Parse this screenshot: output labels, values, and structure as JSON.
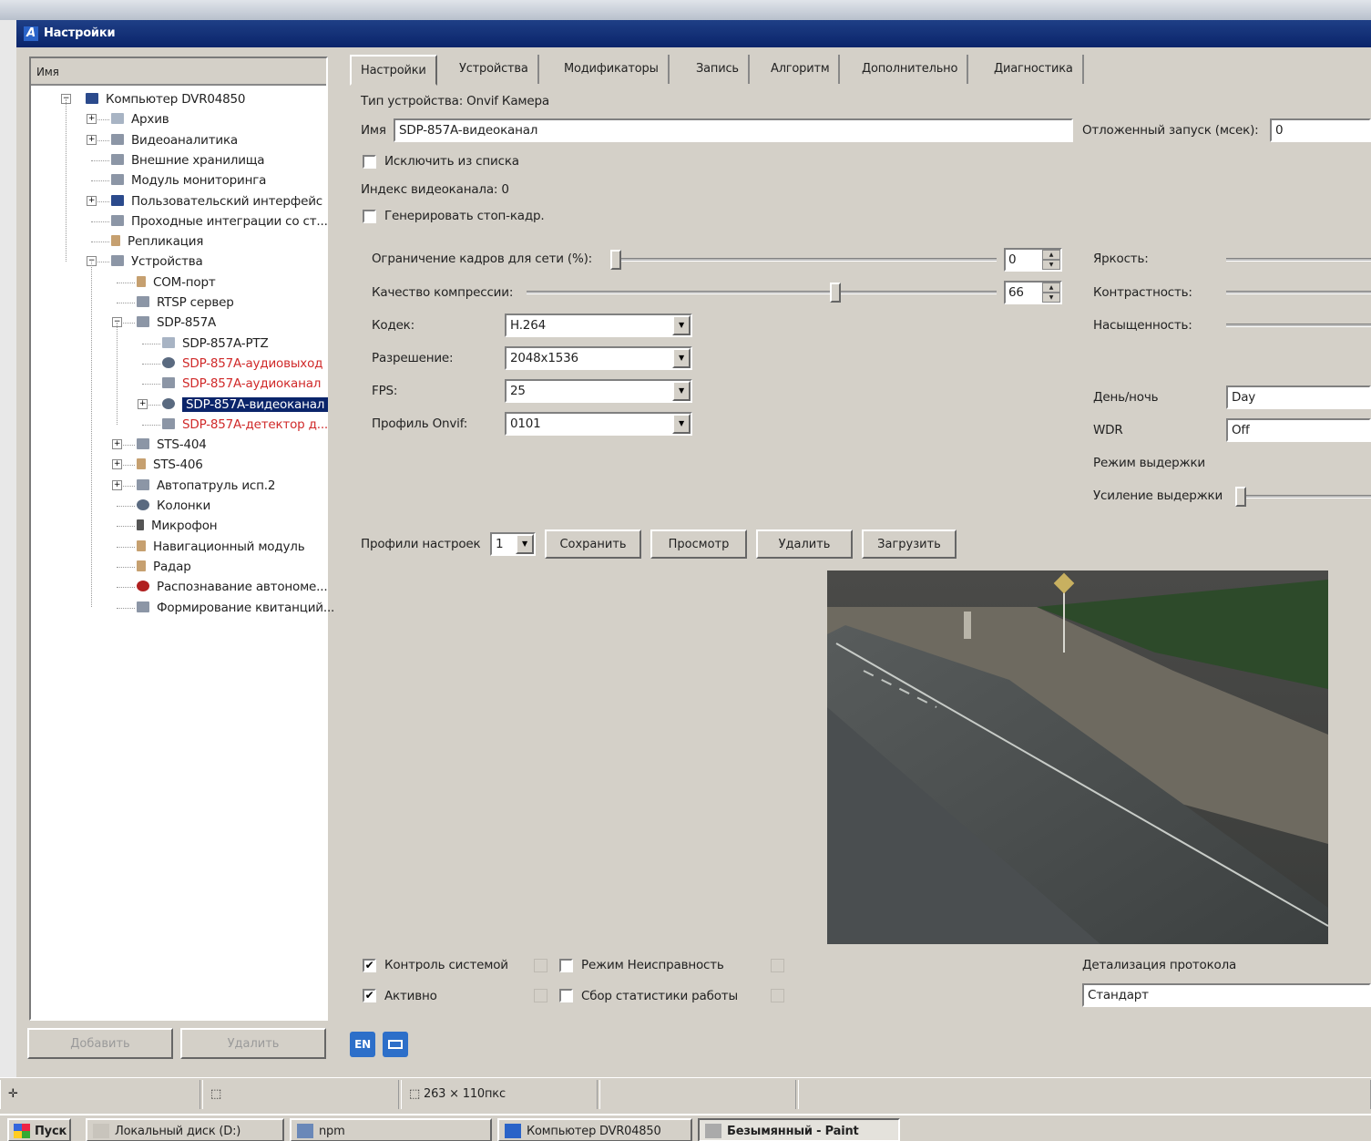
{
  "window": {
    "title": "Настройки"
  },
  "tree": {
    "header": "Имя",
    "items": [
      {
        "label": "Компьютер DVR04850"
      },
      {
        "label": "Архив"
      },
      {
        "label": "Видеоаналитика"
      },
      {
        "label": "Внешние хранилища"
      },
      {
        "label": "Модуль мониторинга"
      },
      {
        "label": "Пользовательский интерфейс"
      },
      {
        "label": "Проходные интеграции со ст..."
      },
      {
        "label": "Репликация"
      },
      {
        "label": "Устройства"
      },
      {
        "label": "COM-порт"
      },
      {
        "label": "RTSP сервер"
      },
      {
        "label": "SDP-857A"
      },
      {
        "label": "SDP-857A-PTZ"
      },
      {
        "label": "SDP-857A-аудиовыход"
      },
      {
        "label": "SDP-857A-аудиоканал"
      },
      {
        "label": "SDP-857A-видеоканал"
      },
      {
        "label": "SDP-857A-детектор д..."
      },
      {
        "label": "STS-404"
      },
      {
        "label": "STS-406"
      },
      {
        "label": "Автопатруль исп.2"
      },
      {
        "label": "Колонки"
      },
      {
        "label": "Микрофон"
      },
      {
        "label": "Навигационный модуль"
      },
      {
        "label": "Радар"
      },
      {
        "label": "Распознавание автономе..."
      },
      {
        "label": "Формирование квитанций..."
      }
    ]
  },
  "leftbuttons": {
    "add": "Добавить",
    "delete": "Удалить"
  },
  "tabs": [
    "Настройки",
    "Устройства",
    "Модификаторы",
    "Запись",
    "Алгоритм",
    "Дополнительно",
    "Диагностика"
  ],
  "form": {
    "device_type": "Тип устройства: Onvif Камера",
    "name_label": "Имя",
    "name_value": "SDP-857A-видеоканал",
    "delay_label": "Отложенный запуск (мсек):",
    "delay_value": "0",
    "exclude_label": "Исключить из списка",
    "index_label": "Индекс видеоканала: 0",
    "freeze_label": "Генерировать стоп-кадр.",
    "framelimit_label": "Ограничение кадров для сети (%):",
    "framelimit_value": "0",
    "framelimit_level": 0,
    "quality_label": "Качество компрессии:",
    "quality_value": "66",
    "quality_level": 66,
    "codec_label": "Кодек:",
    "codec_value": "H.264",
    "resolution_label": "Разрешение:",
    "resolution_value": "2048x1536",
    "fps_label": "FPS:",
    "fps_value": "25",
    "profile_label": "Профиль Onvif:",
    "profile_value": "0101",
    "brightness_label": "Яркость:",
    "contrast_label": "Контрастность:",
    "saturation_label": "Насыщенность:",
    "daynight_label": "День/ночь",
    "daynight_value": "Day",
    "wdr_label": "WDR",
    "wdr_value": "Off",
    "exposure_mode_label": "Режим выдержки",
    "exposure_gain_label": "Усиление выдержки",
    "settings_profiles_label": "Профили настроек",
    "settings_profile_value": "1",
    "save_btn": "Сохранить",
    "view_btn": "Просмотр",
    "delete_btn": "Удалить",
    "load_btn": "Загрузить",
    "sysctl_label": "Контроль системой",
    "active_label": "Активно",
    "fault_label": "Режим Неисправность",
    "stats_label": "Сбор статистики работы",
    "log_detail_label": "Детализация протокола",
    "log_detail_value": "Стандарт"
  },
  "lang": {
    "en": "EN"
  },
  "statusbar": {
    "size": "263 × 110пкс"
  },
  "taskbar": {
    "start": "Пуск",
    "tasks": [
      "Локальный диск (D:)",
      "npm",
      "Компьютер DVR04850",
      "Безымянный - Paint"
    ]
  },
  "colors": {
    "title_bar": "#0a246a",
    "selection": "#0a246a",
    "error_text": "#d02a2a",
    "lang_button": "#2d6fc9"
  }
}
